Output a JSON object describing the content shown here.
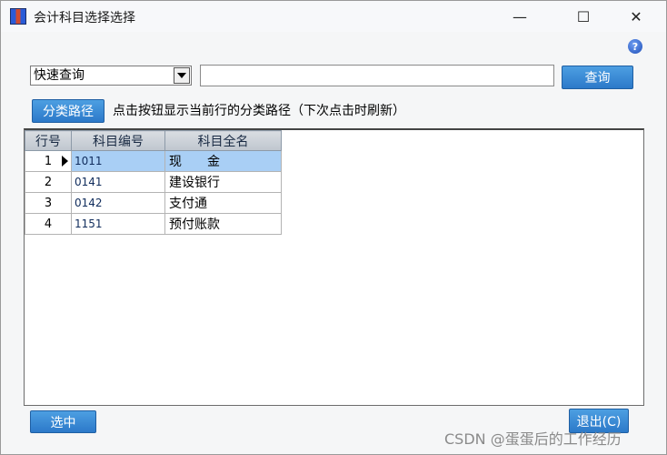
{
  "window": {
    "title": "会计科目选择选择",
    "minimize": "—",
    "maximize": "☐",
    "close": "✕"
  },
  "help_glyph": "?",
  "search": {
    "mode_selected": "快速查询",
    "input_value": "",
    "query_button": "查询"
  },
  "path": {
    "button": "分类路径",
    "hint": "点击按钮显示当前行的分类路径（下次点击时刷新）"
  },
  "grid": {
    "headers": [
      "行号",
      "科目编号",
      "科目全名"
    ],
    "rows": [
      {
        "row": "1",
        "code": "1011",
        "name": "现　　金"
      },
      {
        "row": "2",
        "code": "0141",
        "name": "建设银行"
      },
      {
        "row": "3",
        "code": "0142",
        "name": "支付通"
      },
      {
        "row": "4",
        "code": "1151",
        "name": "预付账款"
      }
    ]
  },
  "footer": {
    "select_button": "选中",
    "exit_button": "退出(C)"
  },
  "watermark": "CSDN @蛋蛋后的工作经历"
}
